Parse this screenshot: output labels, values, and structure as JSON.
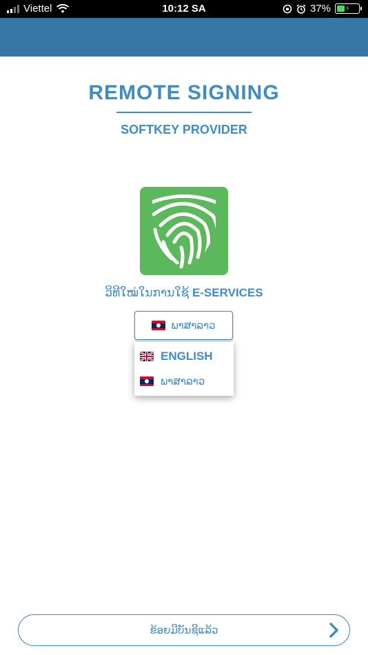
{
  "status_bar": {
    "carrier": "Viettel",
    "time": "10:12 SA",
    "battery": "37%"
  },
  "header": {
    "title": "REMOTE SIGNING",
    "subtitle": "SOFTKEY PROVIDER"
  },
  "logo": {
    "icon": "fingerprint-icon",
    "color": "#5cb85c"
  },
  "tagline": {
    "lao_text": "ວິທີໃໝ່ໃນການໃຊ້",
    "brand_text": "E-SERVICES"
  },
  "language": {
    "selected": "ພາສາລາວ",
    "options": [
      {
        "label": "ENGLISH",
        "flag": "uk-flag-icon"
      },
      {
        "label": "ພາສາລາວ",
        "flag": "lao-flag-icon"
      }
    ]
  },
  "bottom_button": {
    "label": "ຂ້ອຍມີບັນຊີແລ້ວ",
    "icon": "chevron-right-icon"
  },
  "colors": {
    "accent": "#3d8cc4",
    "header_band": "#3777a6",
    "logo_green": "#5cb85c"
  }
}
